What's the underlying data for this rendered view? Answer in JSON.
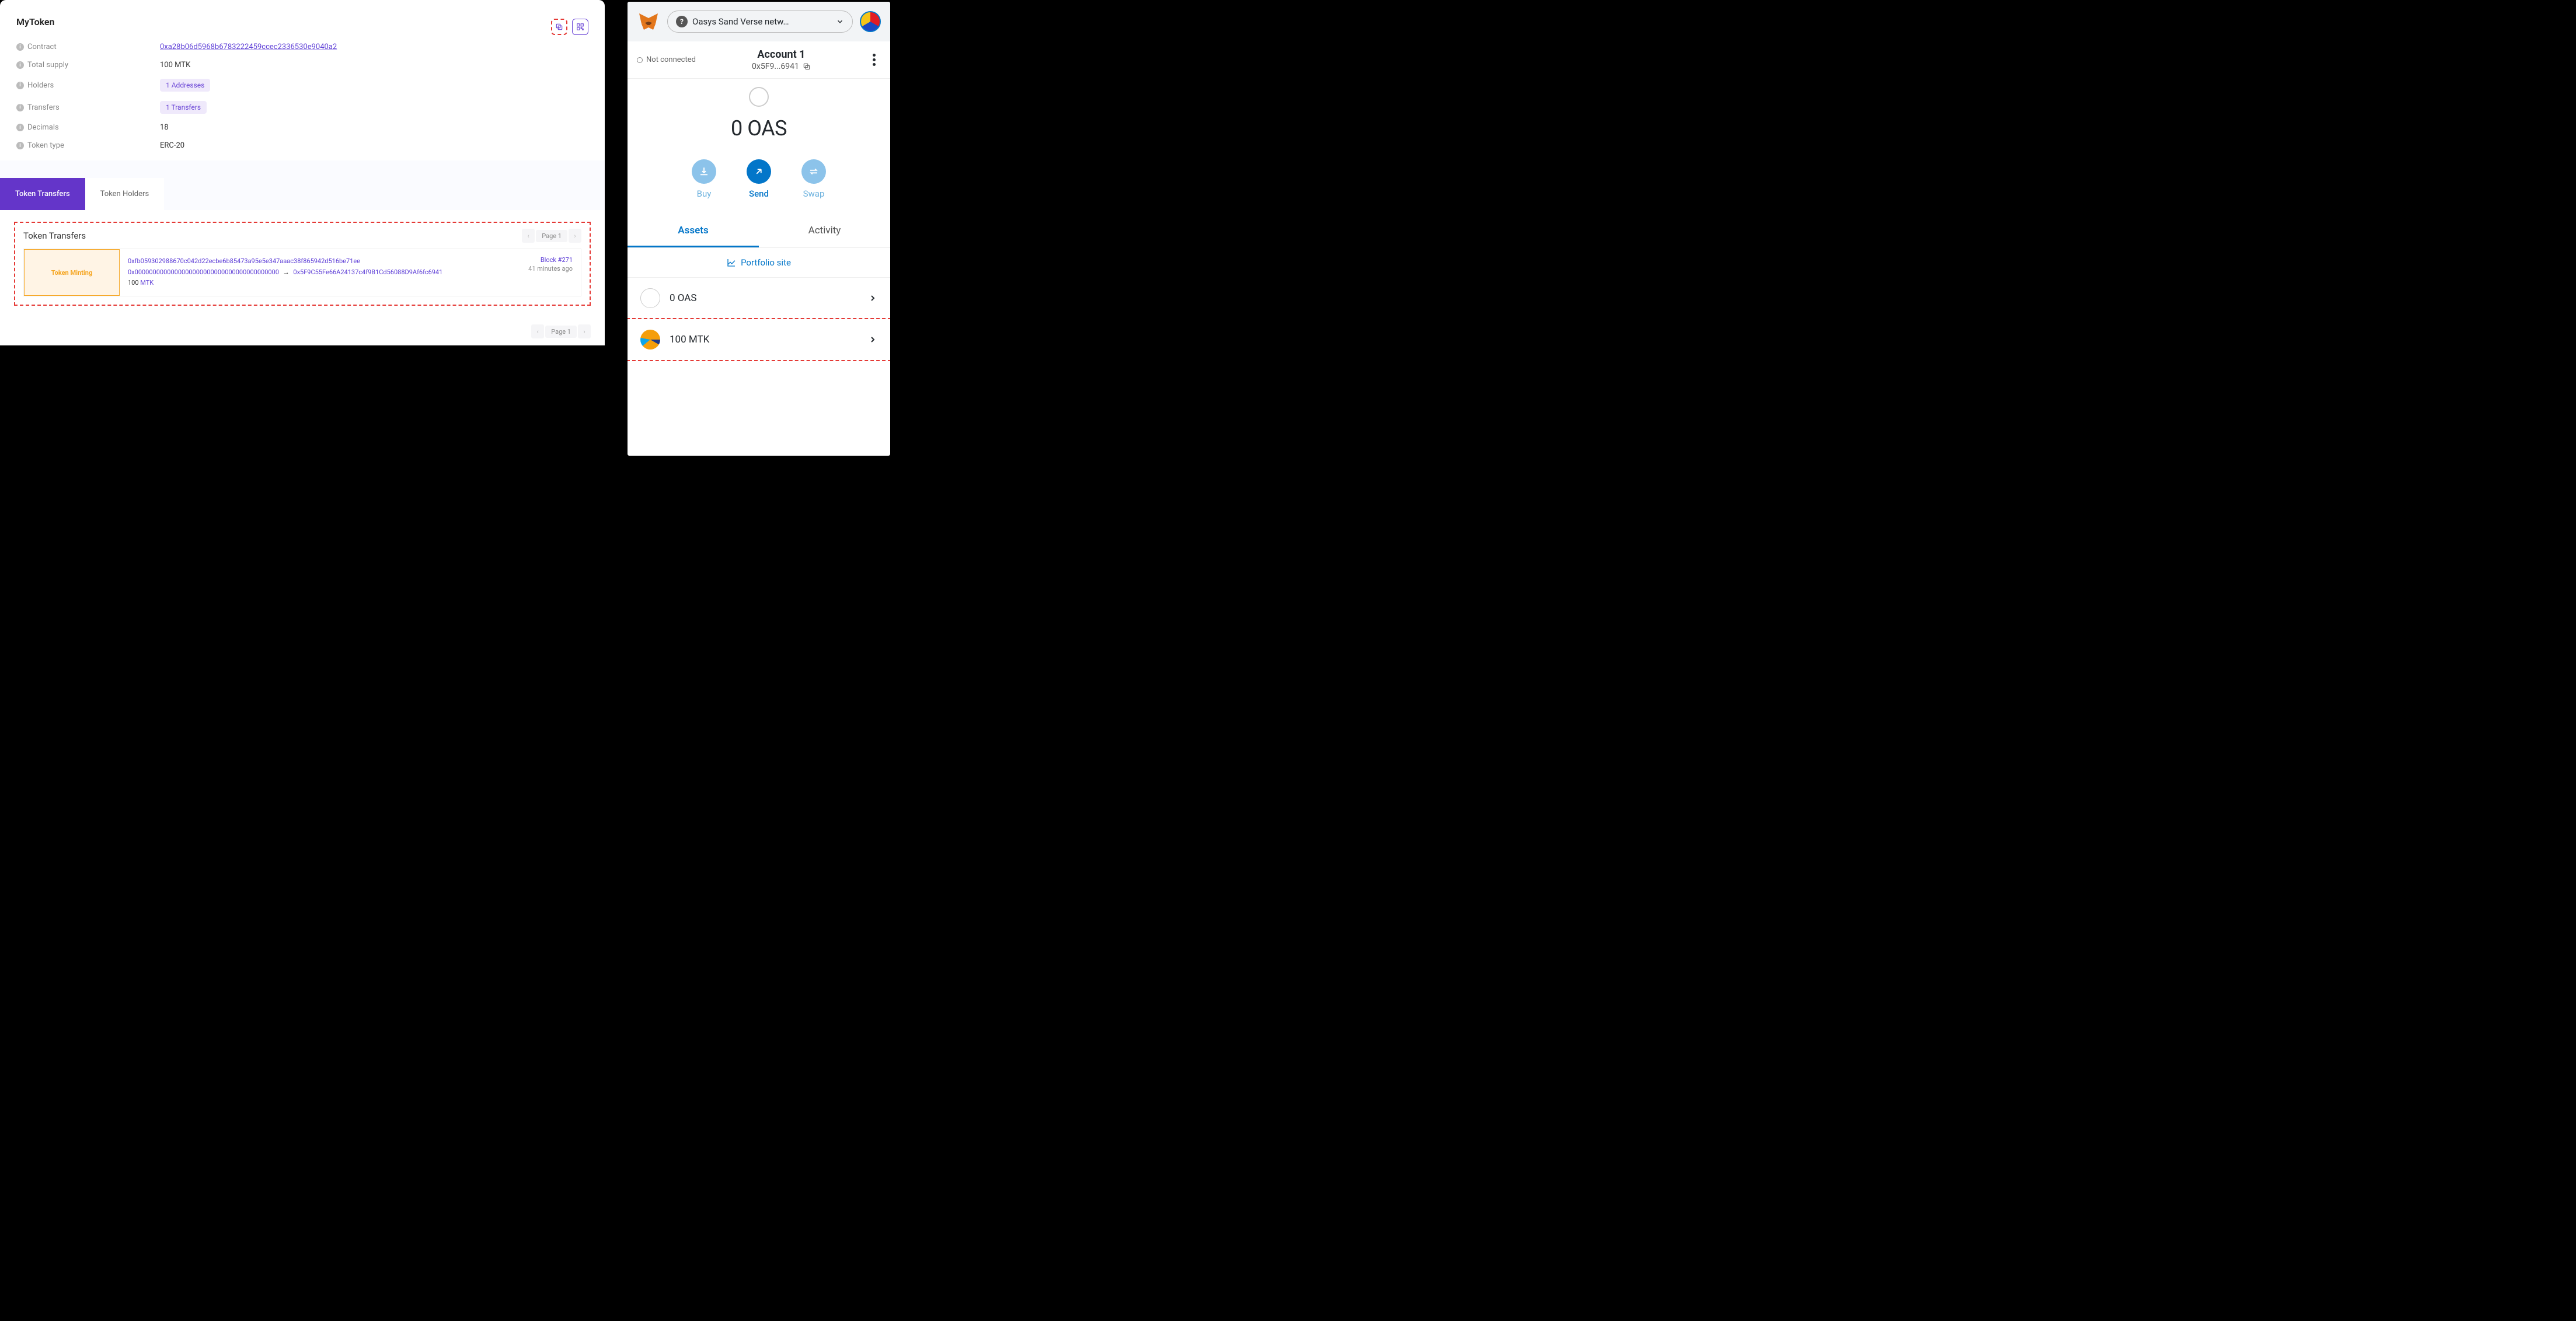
{
  "explorer": {
    "token_name": "MyToken",
    "details": {
      "contract_label": "Contract",
      "contract_value": "0xa28b06d5968b6783222459ccec2336530e9040a2",
      "supply_label": "Total supply",
      "supply_value": "100 MTK",
      "holders_label": "Holders",
      "holders_value": "1 Addresses",
      "transfers_label": "Transfers",
      "transfers_value": "1 Transfers",
      "decimals_label": "Decimals",
      "decimals_value": "18",
      "type_label": "Token type",
      "type_value": "ERC-20"
    },
    "tabs": {
      "transfers": "Token Transfers",
      "holders": "Token Holders"
    },
    "transfers_section": {
      "title": "Token Transfers",
      "page_label": "Page 1",
      "row": {
        "tag": "Token Minting",
        "tx_hash": "0xfb059302988670c042d22ecbe6b85473a95e5e347aaac38f865942d516be71ee",
        "from": "0x0000000000000000000000000000000000000000",
        "to": "0x5F9C55Fe66A24137c4f9B1Cd56088D9Af6fc6941",
        "amount": "100",
        "symbol": "MTK",
        "block": "Block #271",
        "time": "41 minutes ago"
      }
    }
  },
  "wallet": {
    "network": "Oasys Sand Verse netw…",
    "connection_status": "Not connected",
    "account_name": "Account 1",
    "account_short": "0x5F9...6941",
    "balance": "0 OAS",
    "actions": {
      "buy": "Buy",
      "send": "Send",
      "swap": "Swap"
    },
    "tabs": {
      "assets": "Assets",
      "activity": "Activity"
    },
    "portfolio": "Portfolio site",
    "assets": [
      {
        "label": "0 OAS"
      },
      {
        "label": "100 MTK"
      }
    ]
  }
}
